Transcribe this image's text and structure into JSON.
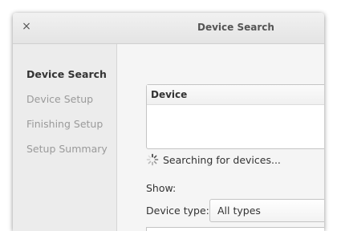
{
  "window": {
    "title": "Device Search",
    "close_glyph": "×"
  },
  "sidebar": {
    "items": [
      {
        "label": "Device Search",
        "active": true
      },
      {
        "label": "Device Setup",
        "active": false
      },
      {
        "label": "Finishing Setup",
        "active": false
      },
      {
        "label": "Setup Summary",
        "active": false
      }
    ]
  },
  "main": {
    "list_header": "Device",
    "status_text": "Searching for devices...",
    "show_label": "Show:",
    "device_type_label": "Device type:",
    "device_type_value": "All types"
  },
  "icons": {
    "spinner": "spinner-icon",
    "close": "close-icon"
  }
}
